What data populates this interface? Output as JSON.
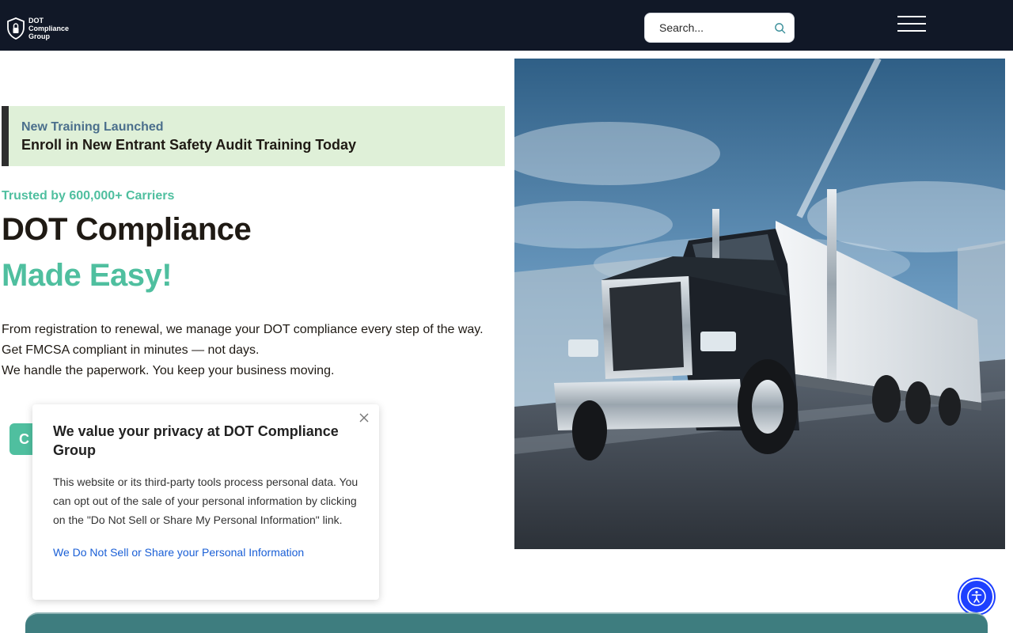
{
  "header": {
    "logo_lines": [
      "DOT",
      "Compliance",
      "Group"
    ],
    "search_placeholder": "Search..."
  },
  "hero": {
    "announcement": {
      "kicker": "New Training Launched",
      "link_text": "Enroll in New Entrant Safety Audit Training Today"
    },
    "trusted_text": "Trusted by 600,000+ Carriers",
    "headline": "DOT Compliance",
    "headline_accent": "Made Easy!",
    "body_lines": [
      "From registration to renewal, we manage your DOT compliance every step of the way.",
      "Get FMCSA compliant in minutes — not days.",
      "We handle the paperwork. You keep your business moving."
    ],
    "cta_visible_text": "C"
  },
  "privacy_popup": {
    "title": "We value your privacy at DOT Compliance Group",
    "text": "This website or its third-party tools process personal data. You can opt out of the sale of your personal information by clicking on the \"Do Not Sell or Share My Personal Information\" link.",
    "link_text": "We Do Not Sell or Share your Personal Information"
  },
  "colors": {
    "header_bg": "#111827",
    "accent": "#4fbf9f",
    "announcement_bg": "#dff0d8",
    "link_blue": "#1a5fd6",
    "a11y_blue": "#1e40ff",
    "band_teal": "#3e7d7f"
  },
  "icons": {
    "logo": "shield-lock-icon",
    "search": "search-icon",
    "menu": "hamburger-menu-icon",
    "close": "close-icon",
    "accessibility": "accessibility-person-icon"
  }
}
